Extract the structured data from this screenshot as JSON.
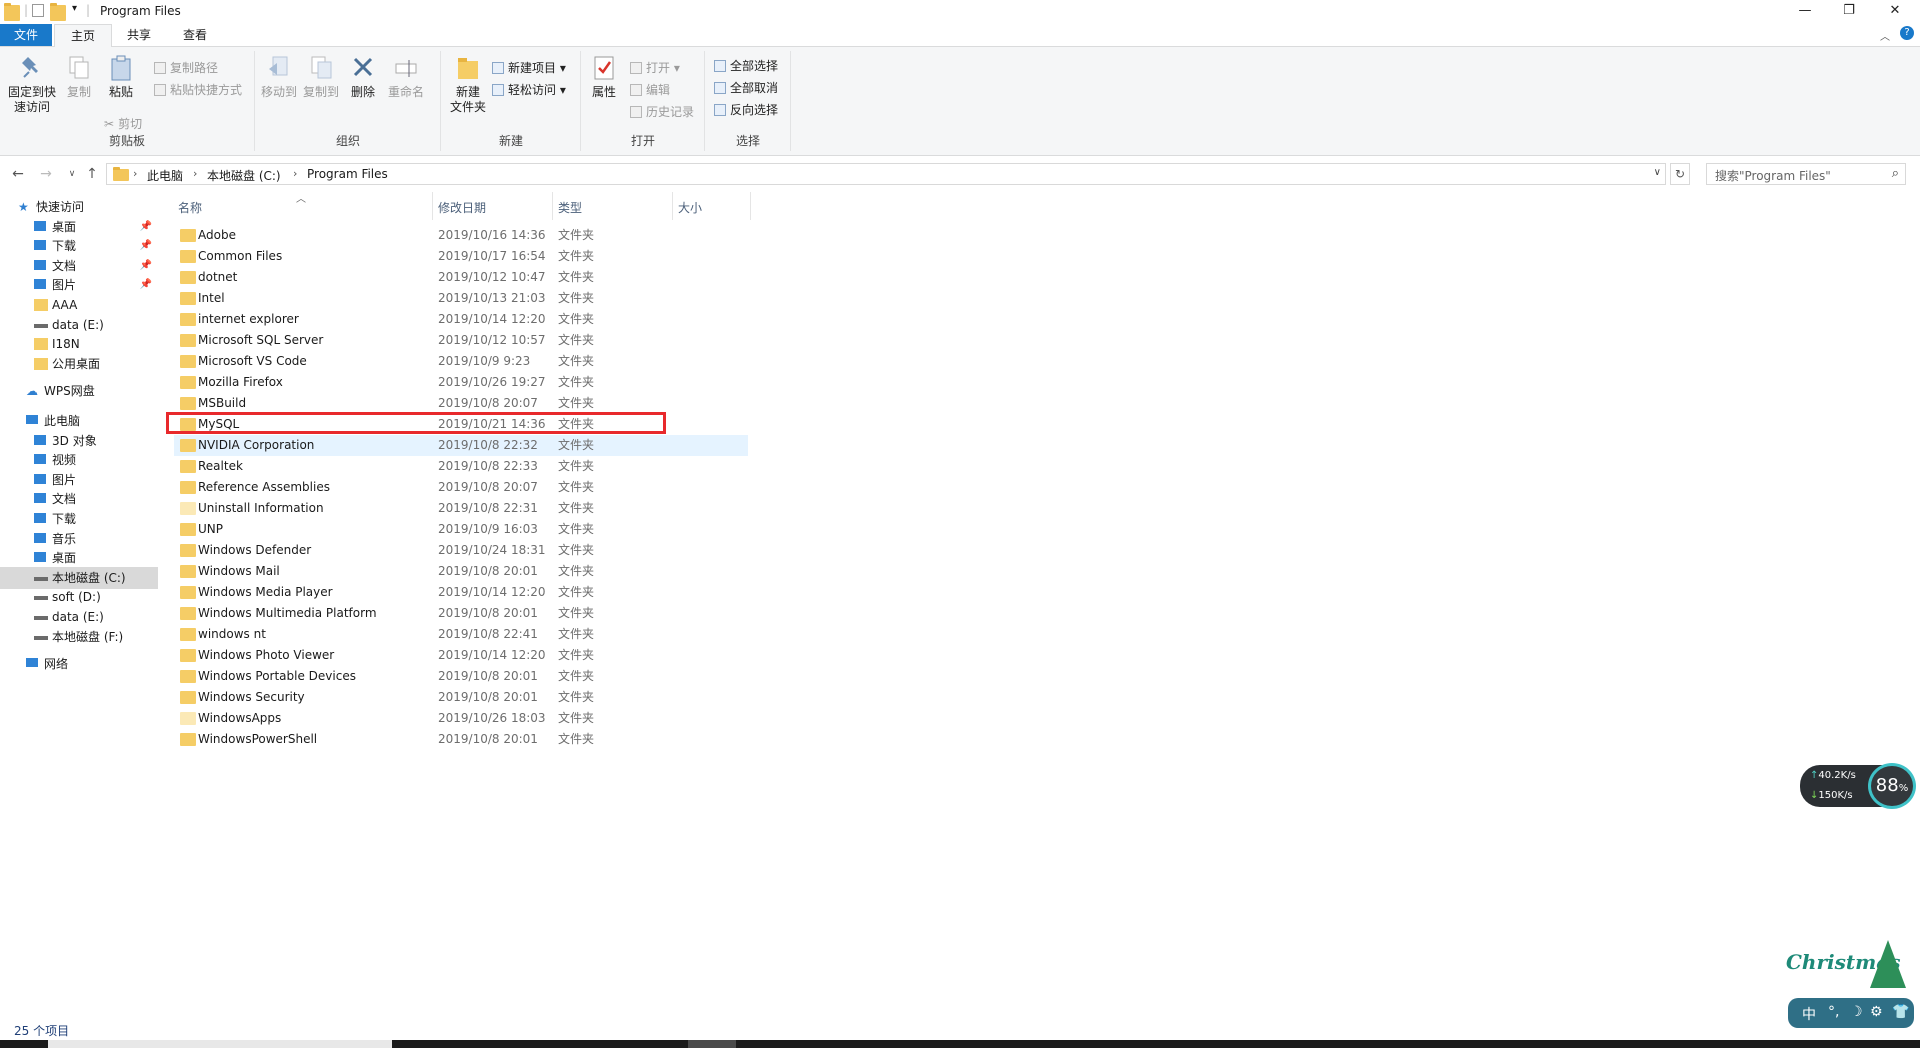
{
  "window": {
    "title": "Program Files",
    "controls": {
      "minimize": "—",
      "maximize": "❐",
      "close": "✕"
    }
  },
  "ribbon_tabs": {
    "file": "文件",
    "home": "主页",
    "share": "共享",
    "view": "查看"
  },
  "ribbon": {
    "clipboard": {
      "pin_line1": "固定到快",
      "pin_line2": "速访问",
      "copy": "复制",
      "paste": "粘贴",
      "copy_path": "复制路径",
      "paste_shortcut": "粘贴快捷方式",
      "cut": "剪切",
      "label": "剪贴板"
    },
    "organize": {
      "move_to": "移动到",
      "copy_to": "复制到",
      "delete": "删除",
      "rename": "重命名",
      "label": "组织"
    },
    "new": {
      "new_folder_line1": "新建",
      "new_folder_line2": "文件夹",
      "new_item": "新建项目 ▾",
      "easy_access": "轻松访问 ▾",
      "label": "新建"
    },
    "open": {
      "properties": "属性",
      "open": "打开 ▾",
      "edit": "编辑",
      "history": "历史记录",
      "label": "打开"
    },
    "select": {
      "select_all": "全部选择",
      "select_none": "全部取消",
      "invert": "反向选择",
      "label": "选择"
    }
  },
  "address": {
    "crumbs": [
      "此电脑",
      "本地磁盘 (C:)",
      "Program Files"
    ],
    "search_placeholder": "搜索\"Program Files\""
  },
  "nav_pane": {
    "quick_access": "快速访问",
    "quick_items": [
      "桌面",
      "下载",
      "文档",
      "图片",
      "AAA",
      "data (E:)",
      "I18N",
      "公用桌面"
    ],
    "wps": "WPS网盘",
    "this_pc": "此电脑",
    "pc_items": [
      "3D 对象",
      "视频",
      "图片",
      "文档",
      "下载",
      "音乐",
      "桌面",
      "本地磁盘 (C:)",
      "soft (D:)",
      "data (E:)",
      "本地磁盘 (F:)"
    ],
    "network": "网络"
  },
  "columns": {
    "name": "名称",
    "date": "修改日期",
    "type": "类型",
    "size": "大小"
  },
  "files": [
    {
      "name": "Adobe",
      "date": "2019/10/16 14:36",
      "type": "文件夹"
    },
    {
      "name": "Common Files",
      "date": "2019/10/17 16:54",
      "type": "文件夹"
    },
    {
      "name": "dotnet",
      "date": "2019/10/12 10:47",
      "type": "文件夹"
    },
    {
      "name": "Intel",
      "date": "2019/10/13 21:03",
      "type": "文件夹"
    },
    {
      "name": "internet explorer",
      "date": "2019/10/14 12:20",
      "type": "文件夹"
    },
    {
      "name": "Microsoft SQL Server",
      "date": "2019/10/12 10:57",
      "type": "文件夹"
    },
    {
      "name": "Microsoft VS Code",
      "date": "2019/10/9 9:23",
      "type": "文件夹"
    },
    {
      "name": "Mozilla Firefox",
      "date": "2019/10/26 19:27",
      "type": "文件夹"
    },
    {
      "name": "MSBuild",
      "date": "2019/10/8 20:07",
      "type": "文件夹"
    },
    {
      "name": "MySQL",
      "date": "2019/10/21 14:36",
      "type": "文件夹"
    },
    {
      "name": "NVIDIA Corporation",
      "date": "2019/10/8 22:32",
      "type": "文件夹"
    },
    {
      "name": "Realtek",
      "date": "2019/10/8 22:33",
      "type": "文件夹"
    },
    {
      "name": "Reference Assemblies",
      "date": "2019/10/8 20:07",
      "type": "文件夹"
    },
    {
      "name": "Uninstall Information",
      "date": "2019/10/8 22:31",
      "type": "文件夹"
    },
    {
      "name": "UNP",
      "date": "2019/10/9 16:03",
      "type": "文件夹"
    },
    {
      "name": "Windows Defender",
      "date": "2019/10/24 18:31",
      "type": "文件夹"
    },
    {
      "name": "Windows Mail",
      "date": "2019/10/8 20:01",
      "type": "文件夹"
    },
    {
      "name": "Windows Media Player",
      "date": "2019/10/14 12:20",
      "type": "文件夹"
    },
    {
      "name": "Windows Multimedia Platform",
      "date": "2019/10/8 20:01",
      "type": "文件夹"
    },
    {
      "name": "windows nt",
      "date": "2019/10/8 22:41",
      "type": "文件夹"
    },
    {
      "name": "Windows Photo Viewer",
      "date": "2019/10/14 12:20",
      "type": "文件夹"
    },
    {
      "name": "Windows Portable Devices",
      "date": "2019/10/8 20:01",
      "type": "文件夹"
    },
    {
      "name": "Windows Security",
      "date": "2019/10/8 20:01",
      "type": "文件夹"
    },
    {
      "name": "WindowsApps",
      "date": "2019/10/26 18:03",
      "type": "文件夹"
    },
    {
      "name": "WindowsPowerShell",
      "date": "2019/10/8 20:01",
      "type": "文件夹"
    }
  ],
  "highlighted_file": "MySQL",
  "hovered_file": "NVIDIA Corporation",
  "status": {
    "count": "25 个项目"
  },
  "net_widget": {
    "up": "40.2K/s",
    "down": "150K/s",
    "percent": "88",
    "percent_unit": "%"
  },
  "ime_widget": {
    "banner": "Christmas",
    "lang": "中"
  },
  "colors": {
    "accent": "#1979ca",
    "highlight_box": "#e8292c",
    "folder": "#f5cd66",
    "hover_row": "#e5f3ff"
  }
}
